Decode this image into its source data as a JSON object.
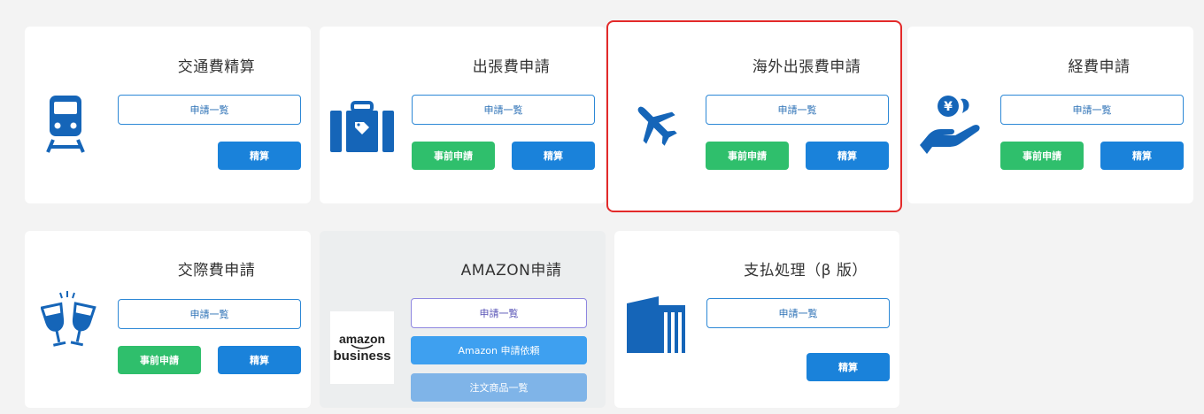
{
  "colors": {
    "accent_blue": "#1a82da",
    "icon_blue": "#1565b8",
    "green": "#2fbf6c",
    "selected_outline": "#e32a2a"
  },
  "cards": [
    {
      "title": "交通費精算",
      "icon": "train-icon",
      "list_label": "申請一覧",
      "settle_label": "精算"
    },
    {
      "title": "出張費申請",
      "icon": "suitcase-icon",
      "list_label": "申請一覧",
      "pre_label": "事前申請",
      "settle_label": "精算"
    },
    {
      "title": "海外出張費申請",
      "icon": "airplane-icon",
      "list_label": "申請一覧",
      "pre_label": "事前申請",
      "settle_label": "精算",
      "selected": true
    },
    {
      "title": "経費申請",
      "icon": "yen-hand-icon",
      "list_label": "申請一覧",
      "pre_label": "事前申請",
      "settle_label": "精算"
    },
    {
      "title": "交際費申請",
      "icon": "toast-glasses-icon",
      "list_label": "申請一覧",
      "pre_label": "事前申請",
      "settle_label": "精算"
    },
    {
      "title": "AMAZON申請",
      "icon": "amazon-business-logo",
      "logo_line1": "amazon",
      "logo_line2": "business",
      "list_label": "申請一覧",
      "request_label": "Amazon 申請依頼",
      "orders_label": "注文商品一覧"
    },
    {
      "title": "支払処理（β 版）",
      "icon": "bank-building-icon",
      "list_label": "申請一覧",
      "settle_label": "精算"
    }
  ]
}
